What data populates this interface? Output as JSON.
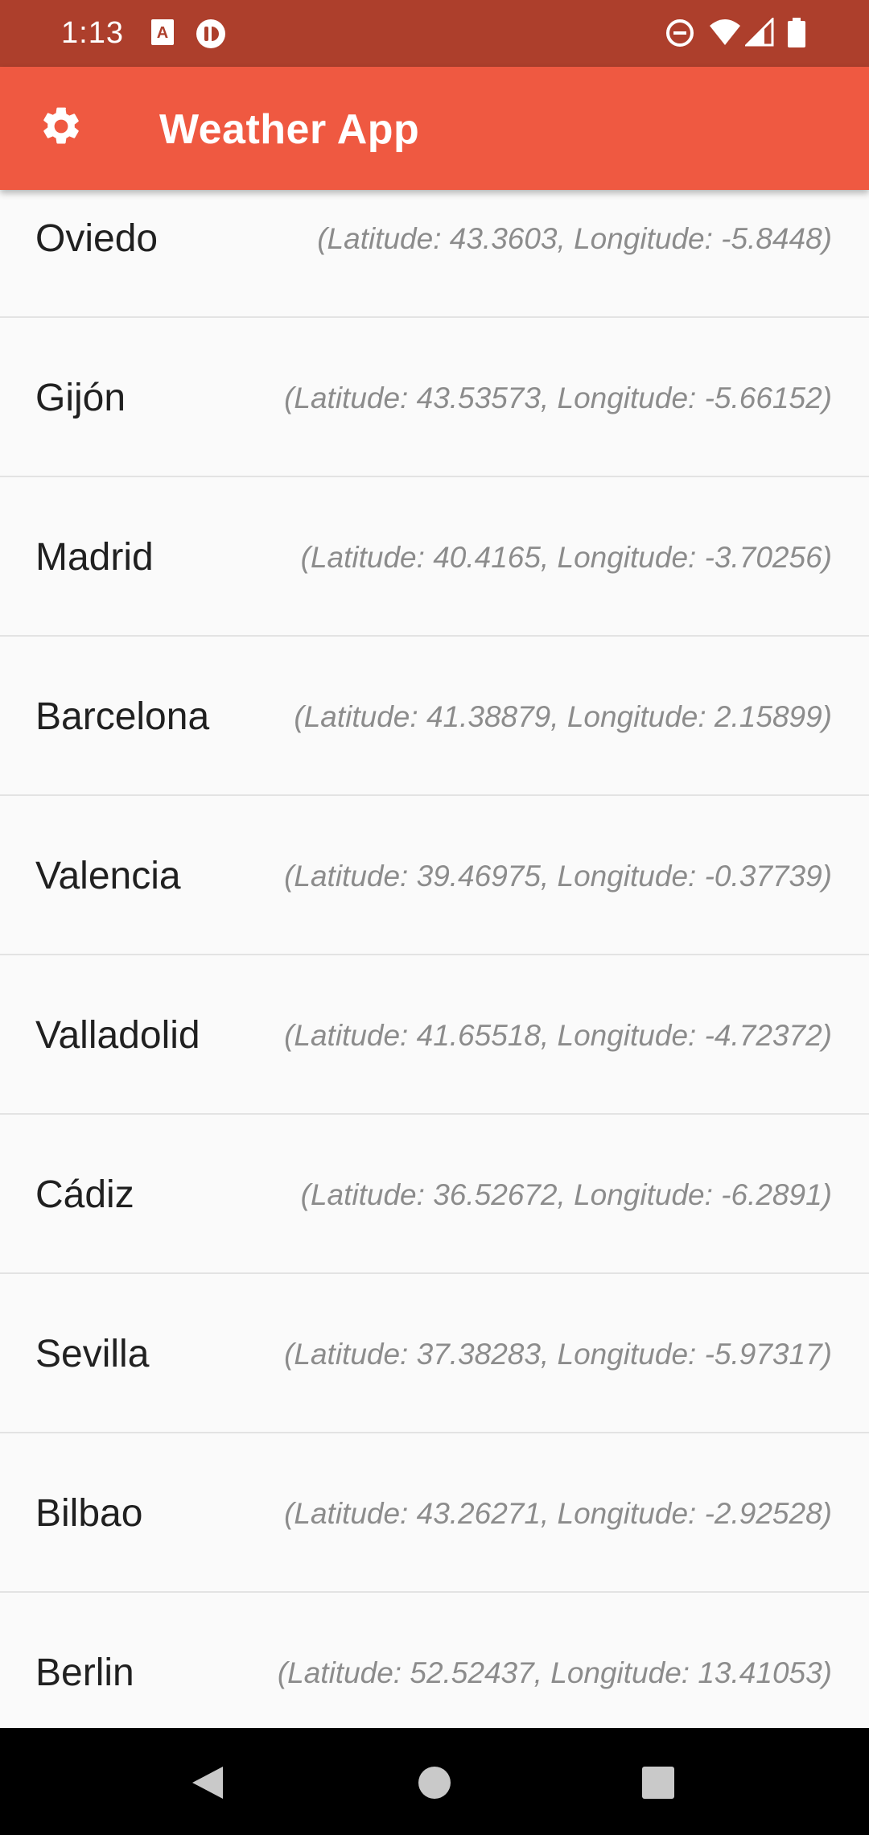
{
  "status_bar": {
    "time": "1:13",
    "notification_icons": [
      "a-icon",
      "recording-icon"
    ],
    "system_icons": [
      "do-not-disturb-icon",
      "wifi-icon",
      "signal-icon",
      "battery-icon"
    ]
  },
  "app_bar": {
    "title": "Weather App",
    "settings_icon": "gear-icon",
    "color": "#ef5941"
  },
  "cities": [
    {
      "name": "Oviedo",
      "coords": "(Latitude: 43.3603, Longitude: -5.8448)"
    },
    {
      "name": "Gijón",
      "coords": "(Latitude: 43.53573, Longitude: -5.66152)"
    },
    {
      "name": "Madrid",
      "coords": "(Latitude: 40.4165, Longitude: -3.70256)"
    },
    {
      "name": "Barcelona",
      "coords": "(Latitude: 41.38879, Longitude: 2.15899)"
    },
    {
      "name": "Valencia",
      "coords": "(Latitude: 39.46975, Longitude: -0.37739)"
    },
    {
      "name": "Valladolid",
      "coords": "(Latitude: 41.65518, Longitude: -4.72372)"
    },
    {
      "name": "Cádiz",
      "coords": "(Latitude: 36.52672, Longitude: -6.2891)"
    },
    {
      "name": "Sevilla",
      "coords": "(Latitude: 37.38283, Longitude: -5.97317)"
    },
    {
      "name": "Bilbao",
      "coords": "(Latitude: 43.26271, Longitude: -2.92528)"
    },
    {
      "name": "Berlin",
      "coords": "(Latitude: 52.52437, Longitude: 13.41053)"
    }
  ],
  "nav_bar": {
    "buttons": [
      "back-icon",
      "home-icon",
      "recents-icon"
    ]
  }
}
